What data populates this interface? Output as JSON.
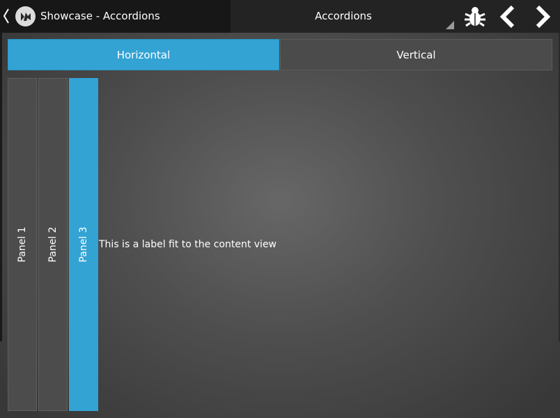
{
  "actionbar": {
    "title": "Showcase - Accordions",
    "spinner_value": "Accordions",
    "icons": {
      "back": "chevron-left-icon",
      "logo": "app-logo-icon",
      "bug": "bug-icon",
      "previous": "arrow-left-icon",
      "next": "arrow-right-icon"
    }
  },
  "tabs": [
    {
      "label": "Horizontal",
      "selected": true
    },
    {
      "label": "Vertical",
      "selected": false
    }
  ],
  "accordion": {
    "panels": [
      {
        "label": "Panel 1",
        "expanded": false
      },
      {
        "label": "Panel 2",
        "expanded": false
      },
      {
        "label": "Panel 3",
        "expanded": true
      }
    ],
    "content_text": "This is a label fit to the content view"
  },
  "colors": {
    "accent": "#33a3d4",
    "panel_idle": "#4c4c4c",
    "actionbar": "#232323"
  }
}
